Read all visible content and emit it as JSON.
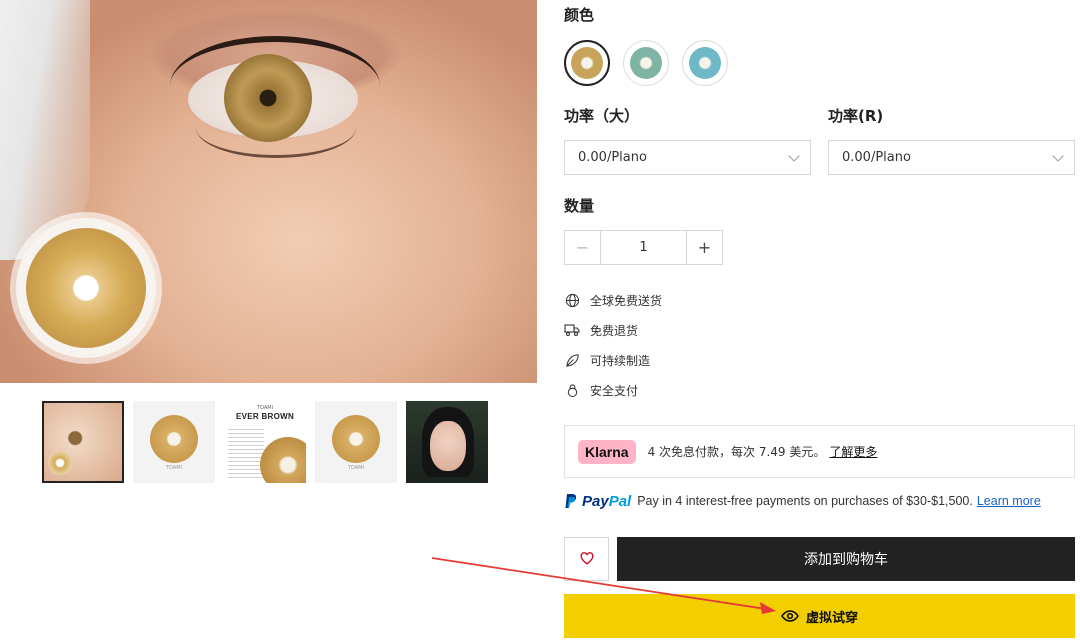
{
  "gallery": {
    "thumbnails": [
      {
        "name": "model-eye"
      },
      {
        "name": "lens-front",
        "caption": "TOAMI"
      },
      {
        "name": "info-card",
        "brand": "TOAMI",
        "title": "EVER BROWN"
      },
      {
        "name": "lens-angle",
        "caption": "TOAMI"
      },
      {
        "name": "model-face"
      }
    ]
  },
  "colors": {
    "label": "颜色",
    "swatches": [
      {
        "name": "brown",
        "color": "#c8a45a",
        "selected": true
      },
      {
        "name": "green",
        "color": "#7fb3a4",
        "selected": false
      },
      {
        "name": "blue",
        "color": "#6fb8c7",
        "selected": false
      }
    ]
  },
  "power_left": {
    "label": "功率（大）",
    "value": "0.00/Plano"
  },
  "power_right": {
    "label": "功率(R)",
    "value": "0.00/Plano"
  },
  "quantity": {
    "label": "数量",
    "value": "1",
    "minus": "−",
    "plus": "+"
  },
  "features": [
    {
      "icon": "globe-icon",
      "text": "全球免费送货"
    },
    {
      "icon": "truck-icon",
      "text": "免费退货"
    },
    {
      "icon": "leaf-icon",
      "text": "可持续制造"
    },
    {
      "icon": "lock-icon",
      "text": "安全支付"
    }
  ],
  "klarna": {
    "logo": "Klarna",
    "text": "4 次免息付款，每次 7.49 美元。",
    "link": "了解更多",
    "brand_color": "#ffb3c7"
  },
  "paypal": {
    "pay": "Pay",
    "pal": "Pal",
    "text": "Pay in 4 interest-free payments on purchases of $30-$1,500.",
    "link": "Learn more"
  },
  "actions": {
    "add_to_cart": "添加到购物车",
    "virtual_try_on": "虚拟试穿",
    "try_on_color": "#f4cf00",
    "cart_color": "#222222"
  }
}
